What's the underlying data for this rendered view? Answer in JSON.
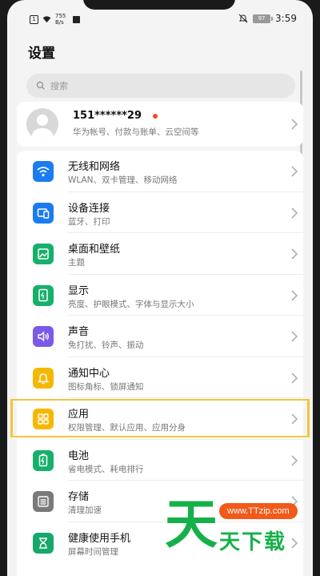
{
  "status_bar": {
    "net_speed": "755\nB/s",
    "battery": "97",
    "time": "3:59"
  },
  "page_title": "设置",
  "search": {
    "placeholder": "搜索"
  },
  "account": {
    "name": "151******29",
    "subtitle": "华为帐号、付款与账单、云空间等"
  },
  "settings_items": [
    {
      "title": "无线和网络",
      "subtitle": "WLAN、双卡管理、移动网络",
      "icon": "wifi-icon",
      "color": "#1a7cf0"
    },
    {
      "title": "设备连接",
      "subtitle": "蓝牙、打印",
      "icon": "device-connection-icon",
      "color": "#1a7cf0"
    },
    {
      "title": "桌面和壁纸",
      "subtitle": "主题",
      "icon": "wallpaper-icon",
      "color": "#16b06a"
    },
    {
      "title": "显示",
      "subtitle": "亮度、护眼模式、字体与显示大小",
      "icon": "display-icon",
      "color": "#16b06a"
    },
    {
      "title": "声音",
      "subtitle": "免打扰、铃声、振动",
      "icon": "sound-icon",
      "color": "#7a5ae6"
    },
    {
      "title": "通知中心",
      "subtitle": "图标角标、锁屏通知",
      "icon": "notification-icon",
      "color": "#f5b800"
    },
    {
      "title": "应用",
      "subtitle": "权限管理、默认应用、应用分身",
      "icon": "apps-icon",
      "color": "#f5b800"
    },
    {
      "title": "电池",
      "subtitle": "省电模式、耗电排行",
      "icon": "battery-icon",
      "color": "#16b06a"
    },
    {
      "title": "存储",
      "subtitle": "清理加速",
      "icon": "storage-icon",
      "color": "#7a7a7a"
    },
    {
      "title": "健康使用手机",
      "subtitle": "屏幕时间管理",
      "icon": "hourglass-icon",
      "color": "#16a86a"
    }
  ],
  "watermark": {
    "url": "www.TTzip.com",
    "big_char": "天",
    "text": "天下载"
  },
  "colors": {
    "highlight": "#f3c53c",
    "notification_dot": "#f04a2a",
    "watermark_green": "#16b04a",
    "watermark_orange": "#f25a1a"
  }
}
